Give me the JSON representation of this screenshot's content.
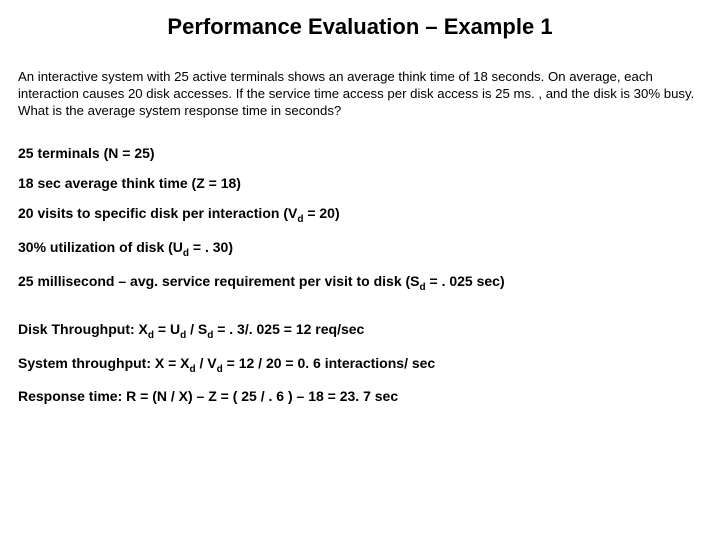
{
  "title": "Performance Evaluation – Example 1",
  "problem": "An interactive system with 25 active terminals shows an average think time of 18 seconds. On average, each interaction causes 20 disk accesses. If the service time access per  disk access is 25 ms. , and the disk is 30% busy. What is the average system response time in seconds?",
  "lines": {
    "l1": "25 terminals (N = 25)",
    "l2": "18 sec average think time (Z = 18)",
    "l3_a": "20 visits to specific disk per interaction (V",
    "l3_b": " = 20)",
    "l4_a": "30% utilization of disk (U",
    "l4_b": " = . 30)",
    "l5_a": "25 millisecond – avg. service requirement per visit to disk (S",
    "l5_b": " = . 025 sec)",
    "l6_a": "Disk Throughput: X",
    "l6_b": " = U",
    "l6_c": " / S",
    "l6_d": "  = . 3/. 025 = 12 req/sec",
    "l7_a": "System throughput:  X  = X",
    "l7_b": " /  V",
    "l7_c": "  = 12 / 20  = 0. 6 interactions/ sec",
    "l8": "Response time:  R  = (N / X) – Z  = ( 25 / . 6 ) – 18  = 23. 7 sec"
  },
  "sub_d": "d"
}
